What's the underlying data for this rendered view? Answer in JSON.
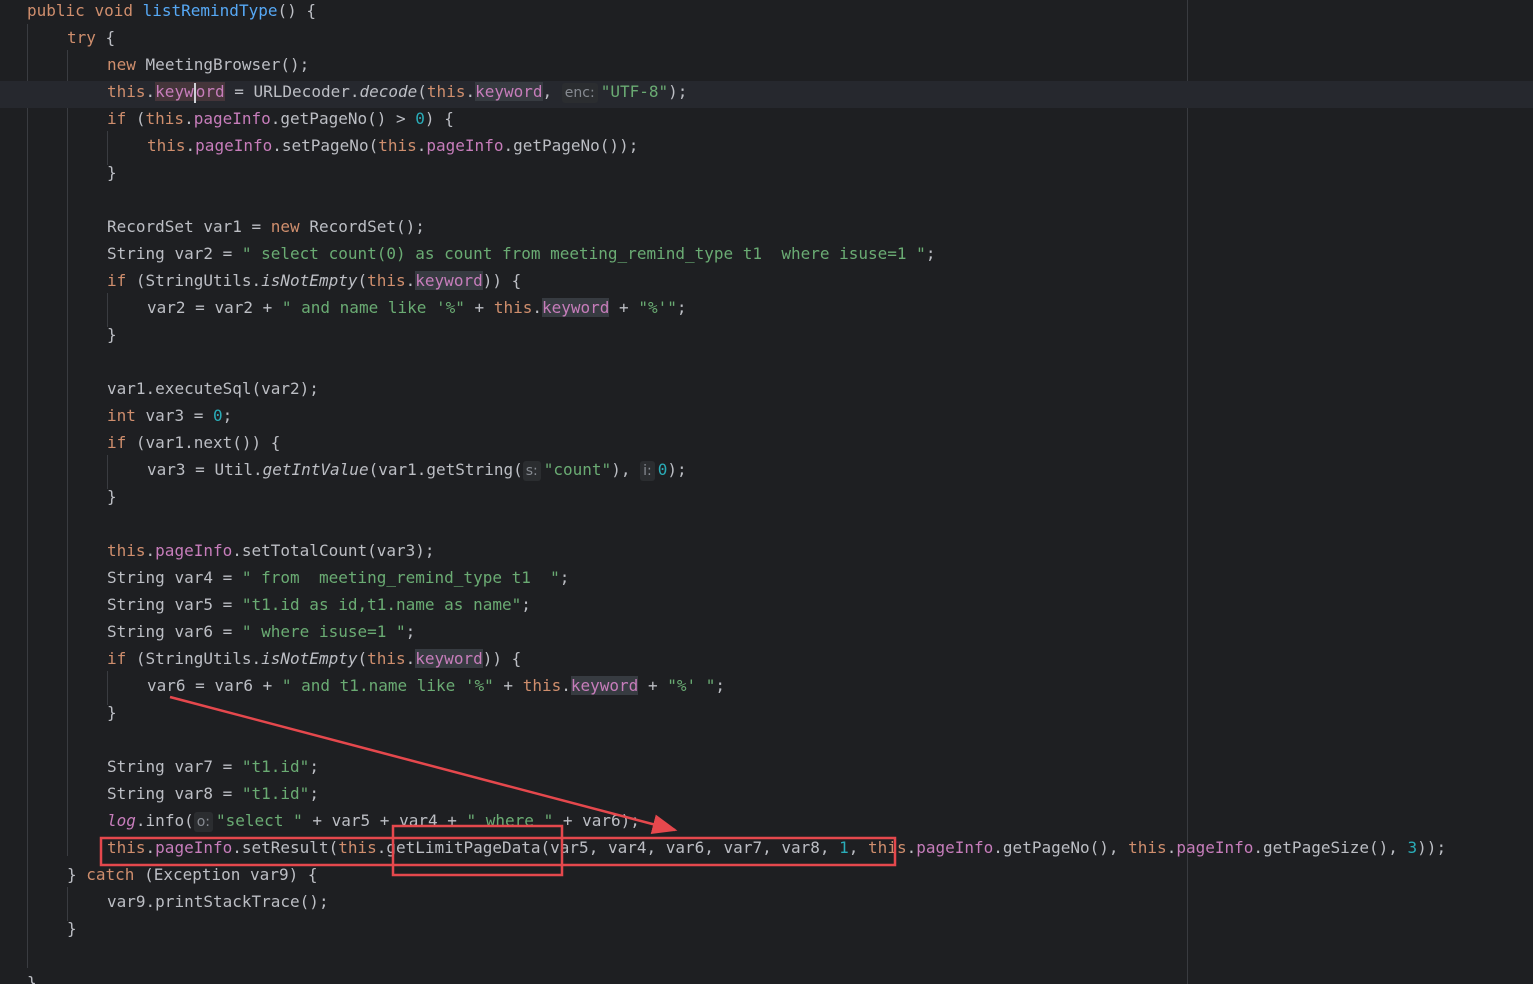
{
  "code": {
    "kw_public": "public",
    "kw_void": "void",
    "method_name": "listRemindType",
    "kw_try": "try",
    "kw_new": "new",
    "cls_meeting_browser": "MeetingBrowser",
    "kw_this": "this",
    "field_keyword_part1": "keyw",
    "field_keyword_part2": "ord",
    "field_keyword": "keyword",
    "cls_url_decoder": "URLDecoder",
    "method_decode": "decode",
    "hint_enc": "enc:",
    "str_utf8": "\"UTF-8\"",
    "kw_if": "if",
    "field_page_info": "pageInfo",
    "method_get_page_no": "getPageNo",
    "num_zero": "0",
    "method_set_page_no": "setPageNo",
    "cls_record_set": "RecordSet",
    "var1": "var1",
    "cls_string": "String",
    "var2": "var2",
    "str_sql_count": "\" select count(0) as count from meeting_remind_type t1  where isuse=1 \"",
    "cls_string_utils": "StringUtils",
    "method_is_not_empty": "isNotEmpty",
    "str_and_name_like": "\" and name like '%\"",
    "str_percent_quote": "\"%'\"",
    "method_execute_sql": "executeSql",
    "kw_int": "int",
    "var3": "var3",
    "method_next": "next",
    "cls_util": "Util",
    "method_get_int_value": "getIntValue",
    "method_get_string": "getString",
    "hint_s": "s:",
    "str_count": "\"count\"",
    "hint_i": "i:",
    "method_set_total_count": "setTotalCount",
    "var4": "var4",
    "str_from": "\" from  meeting_remind_type t1  \"",
    "var5": "var5",
    "str_fields": "\"t1.id as id,t1.name as name\"",
    "var6": "var6",
    "str_where_isuse": "\" where isuse=1 \"",
    "str_and_t1_name_like": "\" and t1.name like '%\"",
    "str_percent_quote_space": "\"%' \"",
    "var7": "var7",
    "str_t1_id": "\"t1.id\"",
    "var8": "var8",
    "field_log": "log",
    "method_info": "info",
    "hint_o": "o:",
    "str_select": "\"select \"",
    "str_where": "\" where \"",
    "method_set_result": "setResult",
    "method_get_limit_page_data": "getLimitPageData",
    "num_one": "1",
    "method_get_page_size": "getPageSize",
    "num_three": "3",
    "kw_catch": "catch",
    "cls_exception": "Exception",
    "var9": "var9",
    "method_print_stack_trace": "printStackTrace"
  },
  "colors": {
    "background": "#1e1f22",
    "keyword": "#cf8e6d",
    "method_declaration": "#56a8f5",
    "field": "#c77dbb",
    "string": "#6aab73",
    "number": "#2aacb8",
    "plain": "#bcbec4",
    "annotation_red": "#e5484d"
  }
}
